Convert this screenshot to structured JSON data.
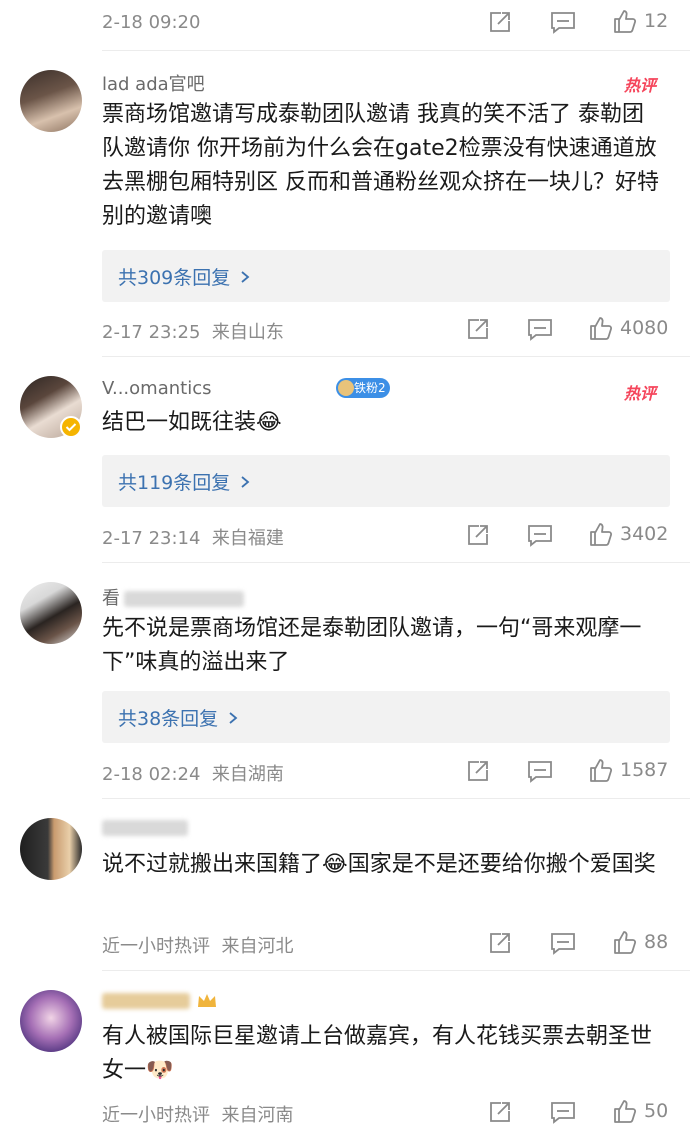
{
  "icons": {
    "share": "share-icon",
    "comment": "comment-icon",
    "like": "thumbs-up-icon",
    "reply_arrow": "chevron-right-icon",
    "verified": "verified-badge-icon"
  },
  "colors": {
    "hot_badge": "#f5455b",
    "reply_link": "#3c72b0",
    "meta": "#8a8a8a"
  },
  "top_meta": {
    "time": "2-18 09:20",
    "likes": "12"
  },
  "comments": [
    {
      "name": "lad  ada官吧",
      "hot": "热评",
      "text": "票商场馆邀请写成泰勒团队邀请 我真的笑不活了 泰勒团队邀请你 你开场前为什么会在gate2检票没有快速通道放去黑棚包厢特别区 反而和普通粉丝观众挤在一块儿？好特别的邀请噢",
      "replies": "共309条回复",
      "time": "2-17 23:25",
      "location": "来自山东",
      "likes": "4080"
    },
    {
      "name": "V...omantics",
      "badge": "铁粉2",
      "hot": "热评",
      "text": "结巴一如既往装😂",
      "replies": "共119条回复",
      "time": "2-17 23:14",
      "location": "来自福建",
      "likes": "3402"
    },
    {
      "name": "看",
      "text": "先不说是票商场馆还是泰勒团队邀请，一句“哥来观摩一下”味真的溢出来了",
      "replies": "共38条回复",
      "time": "2-18 02:24",
      "location": "来自湖南",
      "likes": "1587"
    },
    {
      "name": "",
      "text": "说不过就搬出来国籍了😂国家是不是还要给你搬个爱国奖",
      "time": "近一小时热评",
      "location": "来自河北",
      "likes": "88"
    },
    {
      "name": "",
      "text": "有人被国际巨星邀请上台做嘉宾，有人花钱买票去朝圣世女一🐶",
      "time": "近一小时热评",
      "location": "来自河南",
      "likes": "50"
    }
  ]
}
